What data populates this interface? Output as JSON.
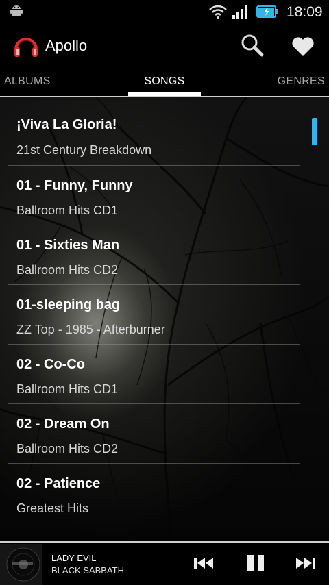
{
  "status_bar": {
    "time": "18:09"
  },
  "app": {
    "title": "Apollo"
  },
  "tabs": [
    {
      "label": "ALBUMS"
    },
    {
      "label": "SONGS",
      "selected": true
    },
    {
      "label": "GENRES"
    }
  ],
  "songs": [
    {
      "title": "¡Viva La Gloria!",
      "subtitle": "21st Century Breakdown"
    },
    {
      "title": "01 - Funny, Funny",
      "subtitle": "Ballroom Hits CD1"
    },
    {
      "title": "01 - Sixties Man",
      "subtitle": "Ballroom Hits CD2"
    },
    {
      "title": "01-sleeping bag",
      "subtitle": "ZZ Top - 1985 - Afterburner"
    },
    {
      "title": "02 - Co-Co",
      "subtitle": "Ballroom Hits CD1"
    },
    {
      "title": "02 - Dream On",
      "subtitle": "Ballroom Hits CD2"
    },
    {
      "title": "02 - Patience",
      "subtitle": "Greatest Hits"
    }
  ],
  "now_playing": {
    "title": "LADY EVIL",
    "artist": "BLACK SABBATH"
  },
  "colors": {
    "accent": "#33b5e5",
    "headphone_red": "#d8302f",
    "background": "#000000"
  }
}
